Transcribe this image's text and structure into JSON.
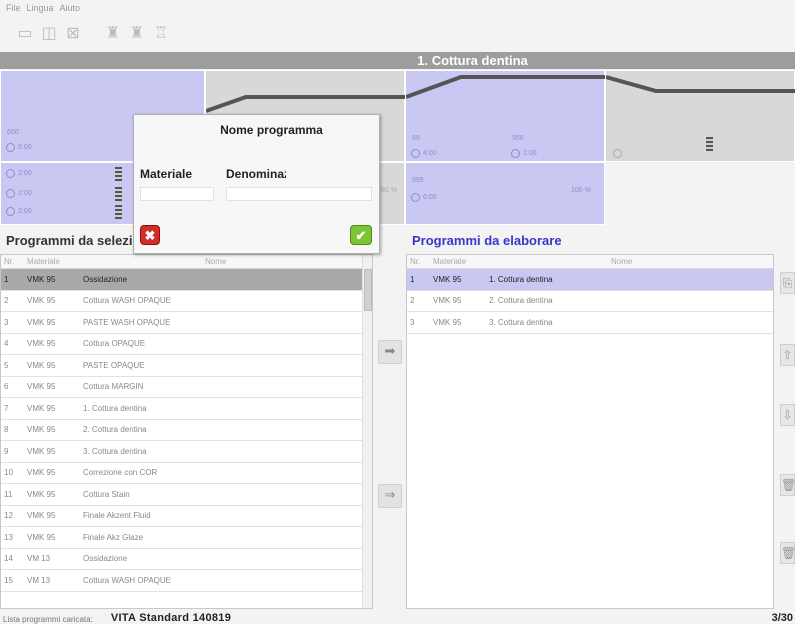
{
  "menu": [
    "File",
    "Lingua",
    "Aiuto"
  ],
  "toolbar": {
    "icons": [
      "open-folder-icon",
      "save-icon",
      "delete-program-icon",
      "left-furnace-icon",
      "right-furnace-icon",
      "furnace-icon"
    ]
  },
  "program_title": "1. Cottura dentina",
  "cells": {
    "top": [
      {
        "line1": "600",
        "line2": "6:00"
      },
      {
        "line1": "",
        "line2": ""
      },
      {
        "line1": "55",
        "line2": "4:00",
        "line3": "950",
        "line4": "1:00"
      },
      {
        "line1": "",
        "line2": "",
        "line3": ""
      }
    ],
    "bottom": [
      {
        "line1": "2:00",
        "line2": "2:00",
        "line3": "2:00"
      },
      {
        "pct": "80 %"
      },
      {
        "line1": "895",
        "line2": "6:00",
        "pct": "100 %"
      }
    ]
  },
  "dialog": {
    "title": "Nome programma",
    "material_label": "Materiale",
    "name_label": "Denominazione",
    "material_value": "",
    "name_value": ""
  },
  "left_panel": {
    "title": "Programmi da selezionare",
    "columns": [
      "Nr.",
      "Materiale",
      "Nome"
    ],
    "rows": [
      {
        "nr": "1",
        "mat": "VMK 95",
        "name": "Ossidazione"
      },
      {
        "nr": "2",
        "mat": "VMK 95",
        "name": "Cottura WASH OPAQUE"
      },
      {
        "nr": "3",
        "mat": "VMK 95",
        "name": "PASTE WASH OPAQUE"
      },
      {
        "nr": "4",
        "mat": "VMK 95",
        "name": "Cottura OPAQUE"
      },
      {
        "nr": "5",
        "mat": "VMK 95",
        "name": "PASTE OPAQUE"
      },
      {
        "nr": "6",
        "mat": "VMK 95",
        "name": "Cottura MARGIN"
      },
      {
        "nr": "7",
        "mat": "VMK 95",
        "name": "1. Cottura dentina"
      },
      {
        "nr": "8",
        "mat": "VMK 95",
        "name": "2. Cottura dentina"
      },
      {
        "nr": "9",
        "mat": "VMK 95",
        "name": "3. Cottura dentina"
      },
      {
        "nr": "10",
        "mat": "VMK 95",
        "name": "Correzione con COR"
      },
      {
        "nr": "11",
        "mat": "VMK 95",
        "name": "Cottura Stain"
      },
      {
        "nr": "12",
        "mat": "VMK 95",
        "name": "Finale Akzent Fluid"
      },
      {
        "nr": "13",
        "mat": "VMK 95",
        "name": "Finale Akz Glaze"
      },
      {
        "nr": "14",
        "mat": "VM 13",
        "name": "Ossidazione"
      },
      {
        "nr": "15",
        "mat": "VM 13",
        "name": "Cottura WASH OPAQUE"
      }
    ]
  },
  "right_panel": {
    "title": "Programmi da elaborare",
    "columns": [
      "Nr.",
      "Materiale",
      "Nome"
    ],
    "rows": [
      {
        "nr": "1",
        "mat": "VMK 95",
        "name": "1. Cottura dentina"
      },
      {
        "nr": "2",
        "mat": "VMK 95",
        "name": "2. Cottura dentina"
      },
      {
        "nr": "3",
        "mat": "VMK 95",
        "name": "3. Cottura dentina"
      }
    ]
  },
  "status": {
    "label": "Lista programmi caricata:",
    "list_name": "VITA Standard 140819",
    "count": "3/30"
  },
  "colors": {
    "accent_blue": "#c9c8f3",
    "title_gray": "#9d9d9d",
    "panel_title_blue": "#3a35c9"
  }
}
